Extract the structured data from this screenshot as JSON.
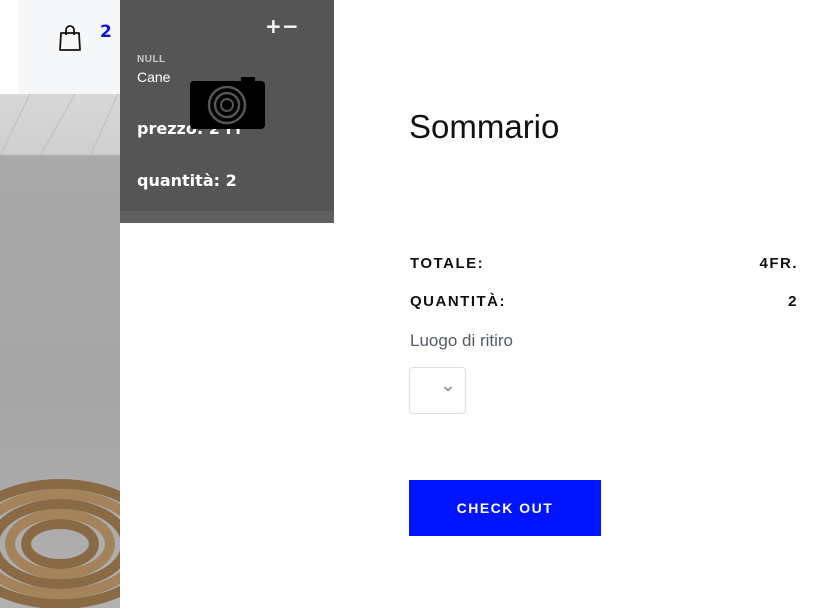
{
  "cart": {
    "icon": "shopping-bag-icon",
    "count": "2"
  },
  "item": {
    "add_label": "+",
    "remove_label": "−",
    "category": "NULL",
    "name": "Cane",
    "image_icon": "camera-icon",
    "price_text": "prezzo: 2 Fr",
    "quantity_text": "quantità: 2"
  },
  "summary": {
    "title": "Sommario",
    "total_label": "TOTALE:",
    "total_value": "4FR.",
    "quantity_label": "QUANTITÀ:",
    "quantity_value": "2",
    "pickup_label": "Luogo di ritiro",
    "pickup_selected": "",
    "checkout_label": "CHECK OUT"
  },
  "colors": {
    "accent": "#0014ff",
    "badge": "#0a14c8",
    "item_panel": "#555555"
  }
}
